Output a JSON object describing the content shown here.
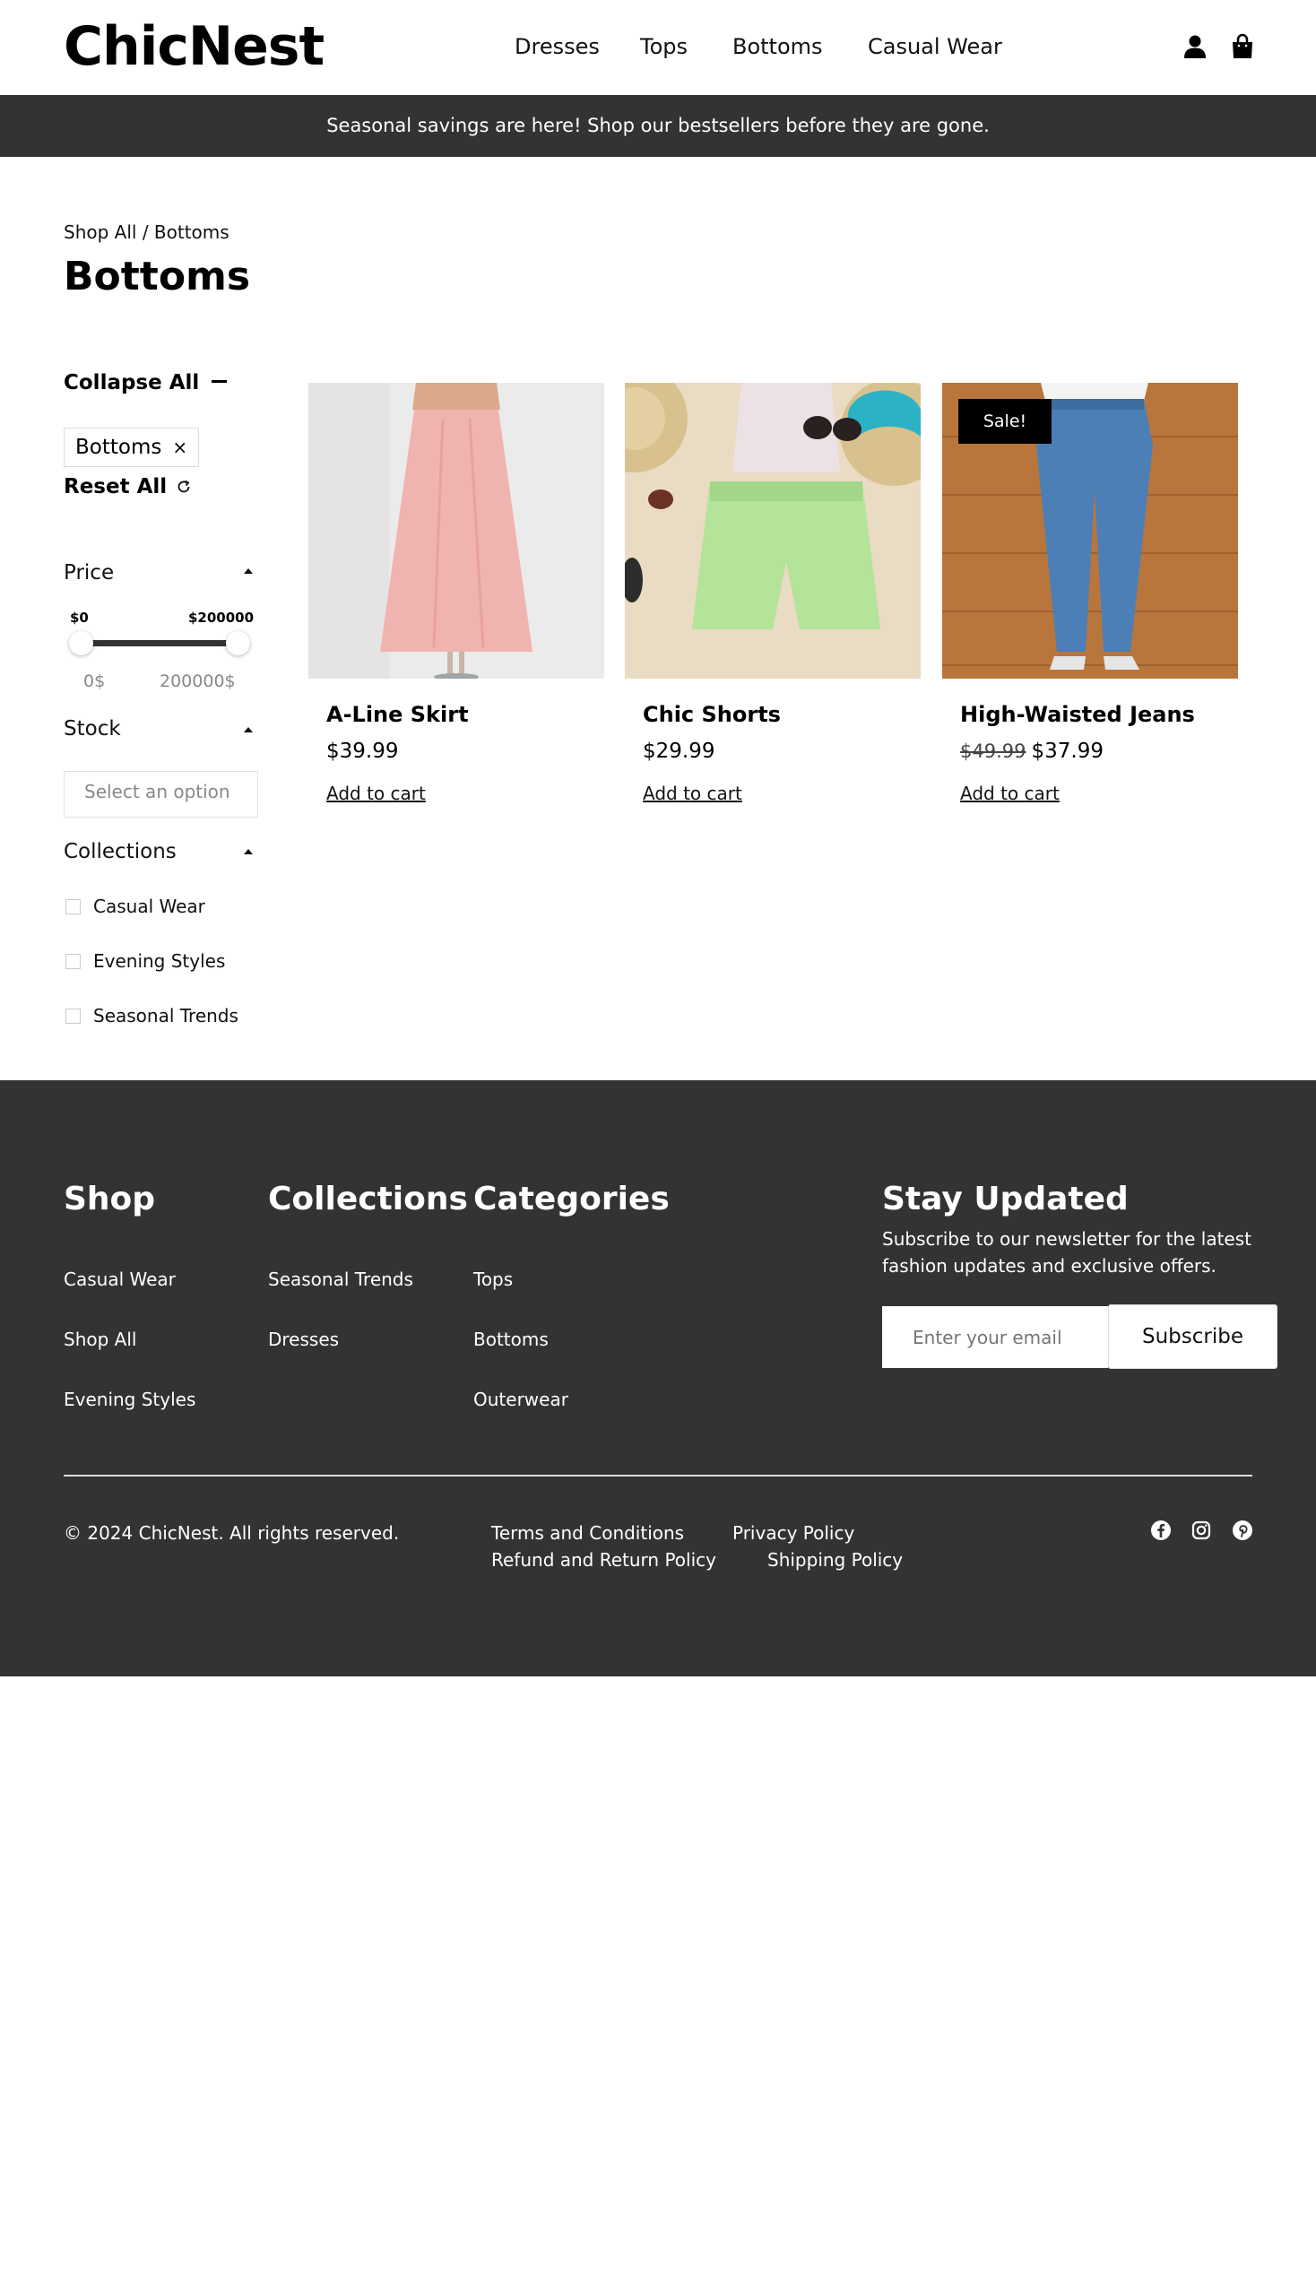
{
  "header": {
    "logo": "ChicNest",
    "nav": [
      "Dresses",
      "Tops",
      "Bottoms",
      "Casual Wear"
    ],
    "icons": [
      "user-icon",
      "shopping-bag-icon"
    ]
  },
  "banner": {
    "text": "Seasonal savings are here! Shop our bestsellers before they are gone."
  },
  "breadcrumb": {
    "text": "Shop All / Bottoms"
  },
  "page_title": "Bottoms",
  "sidebar": {
    "collapse_all": "Collapse All",
    "active_filter": "Bottoms",
    "remove_icon": "×",
    "reset_all": "Reset All",
    "price": {
      "title": "Price",
      "min_label": "$0",
      "max_label": "$200000",
      "min_value": "0$",
      "max_value": "200000$"
    },
    "stock": {
      "title": "Stock",
      "placeholder": "Select an option"
    },
    "collections": {
      "title": "Collections",
      "options": [
        "Casual Wear",
        "Evening Styles",
        "Seasonal Trends"
      ]
    }
  },
  "products": [
    {
      "name": "A-Line Skirt",
      "price": "$39.99",
      "old_price": "",
      "cta": "Add to cart",
      "badge": ""
    },
    {
      "name": "Chic Shorts",
      "price": "$29.99",
      "old_price": "",
      "cta": "Add to cart",
      "badge": ""
    },
    {
      "name": "High-Waisted Jeans",
      "price": "$37.99",
      "old_price": "$49.99",
      "cta": "Add to cart",
      "badge": "Sale!"
    }
  ],
  "footer": {
    "shop": {
      "title": "Shop",
      "links": [
        "Casual Wear",
        "Shop All",
        "Evening Styles"
      ]
    },
    "collections": {
      "title": "Collections",
      "links": [
        "Seasonal Trends",
        "Dresses"
      ]
    },
    "categories": {
      "title": "Categories",
      "links": [
        "Tops",
        "Bottoms",
        "Outerwear"
      ]
    },
    "newsletter": {
      "title": "Stay Updated",
      "text": "Subscribe to our newsletter for the latest fashion updates and exclusive offers.",
      "placeholder": "Enter your email",
      "button": "Subscribe"
    },
    "copyright": "© 2024 ChicNest. All rights reserved.",
    "legal": [
      "Terms and Conditions",
      "Privacy Policy",
      "Refund and Return Policy",
      "Shipping Policy"
    ],
    "social": [
      "facebook-icon",
      "instagram-icon",
      "pinterest-icon"
    ]
  },
  "colors": {
    "dark": "#333333",
    "banner_text": "#ffffff",
    "muted": "#888888"
  }
}
